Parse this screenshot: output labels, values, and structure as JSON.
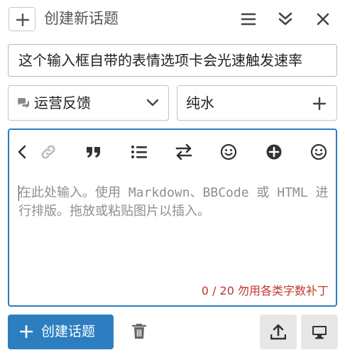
{
  "header": {
    "title": "创建新话题",
    "icons": [
      "plus-icon",
      "menu-icon",
      "double-chevron-down-icon",
      "close-icon"
    ]
  },
  "composer": {
    "title_value": "这个输入框自带的表情选项卡会光速触发速率",
    "category": {
      "label": "运营反馈",
      "icon": "chat-bubble-icon"
    },
    "tag": {
      "label": "纯水"
    },
    "toolbar_icons": [
      "chevron-left-icon",
      "link-icon",
      "quote-icon",
      "list-icon",
      "swap-icon",
      "smile-icon",
      "add-circle-icon",
      "emoji-icon"
    ],
    "placeholder": "在此处输入。使用 Markdown、BBCode 或 HTML 进行排版。拖放或粘贴图片以插入。",
    "counter": "0 / 20 勿用各类字数补丁"
  },
  "footer": {
    "create_label": "创建话题",
    "icons": [
      "trash-icon",
      "upload-icon",
      "monitor-icon"
    ]
  },
  "colors": {
    "accent": "#2c7ec1",
    "counter_red": "#c0392b",
    "gray_button": "#e7e7e7"
  }
}
